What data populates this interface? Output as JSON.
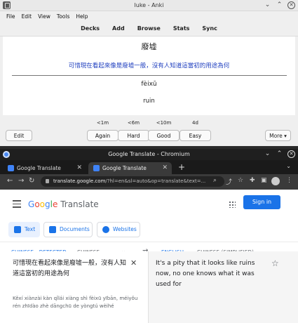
{
  "anki": {
    "window_title": "luke - Anki",
    "menu": [
      "File",
      "Edit",
      "View",
      "Tools",
      "Help"
    ],
    "toolbar": [
      "Decks",
      "Add",
      "Browse",
      "Stats",
      "Sync"
    ],
    "card": {
      "word": "廢墟",
      "sentence": "可惜現在看起來像是廢墟一般，沒有人知道這當初的用途為何",
      "pinyin": "fèixū",
      "meaning": "ruin"
    },
    "answers": [
      {
        "interval": "<1m",
        "label": "Again"
      },
      {
        "interval": "<6m",
        "label": "Hard"
      },
      {
        "interval": "<10m",
        "label": "Good"
      },
      {
        "interval": "4d",
        "label": "Easy"
      }
    ],
    "edit_label": "Edit",
    "more_label": "More ▾"
  },
  "chrome": {
    "window_title": "Google Translate - Chromium",
    "tabs": [
      {
        "label": "Google Translate"
      },
      {
        "label": "Google Translate"
      }
    ],
    "url_host": "translate.google.com",
    "url_rest": "/?hl=en&sl=auto&op=translate&text=..."
  },
  "translate": {
    "logo_google": [
      "G",
      "o",
      "o",
      "g",
      "l",
      "e"
    ],
    "logo_product": "Translate",
    "signin_label": "Sign in",
    "modes": [
      "Text",
      "Documents",
      "Websites"
    ],
    "source_langs": [
      "CHINESE - DETECTED",
      "CHINESE"
    ],
    "target_langs": [
      "ENGLISH",
      "CHINESE (SIMPLIFIED)"
    ],
    "source_text": "可惜現在看起來像是廢墟一般，沒有人知道這當初的用途為何",
    "romanization": "Kěxí xiànzài kàn qǐlái xiàng shì fèixū yībān, méiyǒu rén zhīdào zhè dāngchū de yòngtú wèihé",
    "translation": "It's a pity that it looks like ruins now, no one knows what it was used for"
  }
}
